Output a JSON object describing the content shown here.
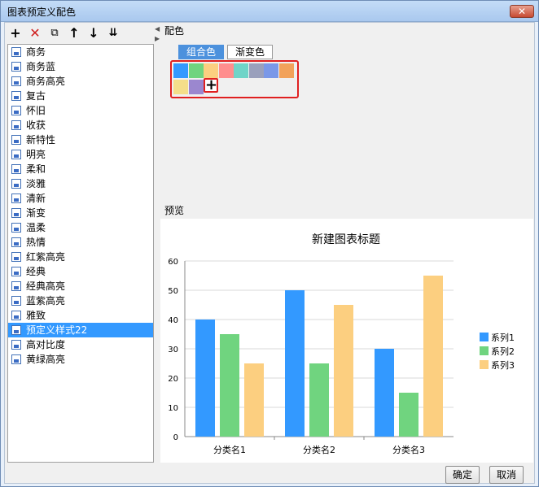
{
  "window": {
    "title": "图表预定义配色",
    "close_label": "✕"
  },
  "toolbar": {
    "add_icon": "plus-icon",
    "delete_icon": "delete-x-icon",
    "copy_icon": "copy-icon",
    "up_icon": "arrow-up-icon",
    "down_icon": "arrow-down-icon",
    "sort_icon": "sort-icon"
  },
  "schemes": [
    {
      "label": "商务"
    },
    {
      "label": "商务蓝"
    },
    {
      "label": "商务高亮"
    },
    {
      "label": "复古"
    },
    {
      "label": "怀旧"
    },
    {
      "label": "收获"
    },
    {
      "label": "新特性"
    },
    {
      "label": "明亮"
    },
    {
      "label": "柔和"
    },
    {
      "label": "淡雅"
    },
    {
      "label": "清新"
    },
    {
      "label": "渐变"
    },
    {
      "label": "温柔"
    },
    {
      "label": "热情"
    },
    {
      "label": "红紫高亮"
    },
    {
      "label": "经典"
    },
    {
      "label": "经典高亮"
    },
    {
      "label": "蓝紫高亮"
    },
    {
      "label": "雅致"
    },
    {
      "label": "预定义样式22"
    },
    {
      "label": "高对比度"
    },
    {
      "label": "黄绿高亮"
    }
  ],
  "selected_scheme": "预定义样式22",
  "palette": {
    "section_label": "配色",
    "tab_combo": "组合色",
    "tab_gradient": "渐变色",
    "colors": [
      "#3399ff",
      "#70d47f",
      "#fccf80",
      "#ff8e8e",
      "#6fd4c8",
      "#9aa0bc",
      "#7a98e8",
      "#f2a25a",
      "#f4de8a",
      "#9b87cf"
    ],
    "add_label": "+"
  },
  "preview": {
    "section_label": "预览"
  },
  "buttons": {
    "ok": "确定",
    "cancel": "取消"
  },
  "chart_data": {
    "type": "bar",
    "title": "新建图表标题",
    "categories": [
      "分类名1",
      "分类名2",
      "分类名3"
    ],
    "series": [
      {
        "name": "系列1",
        "values": [
          40,
          50,
          30
        ],
        "color": "#3399ff"
      },
      {
        "name": "系列2",
        "values": [
          35,
          25,
          15
        ],
        "color": "#70d47f"
      },
      {
        "name": "系列3",
        "values": [
          25,
          45,
          55
        ],
        "color": "#fccf80"
      }
    ],
    "ylim": [
      0,
      60
    ],
    "yticks": [
      0,
      10,
      20,
      30,
      40,
      50,
      60
    ],
    "grid": true,
    "legend": "right"
  }
}
